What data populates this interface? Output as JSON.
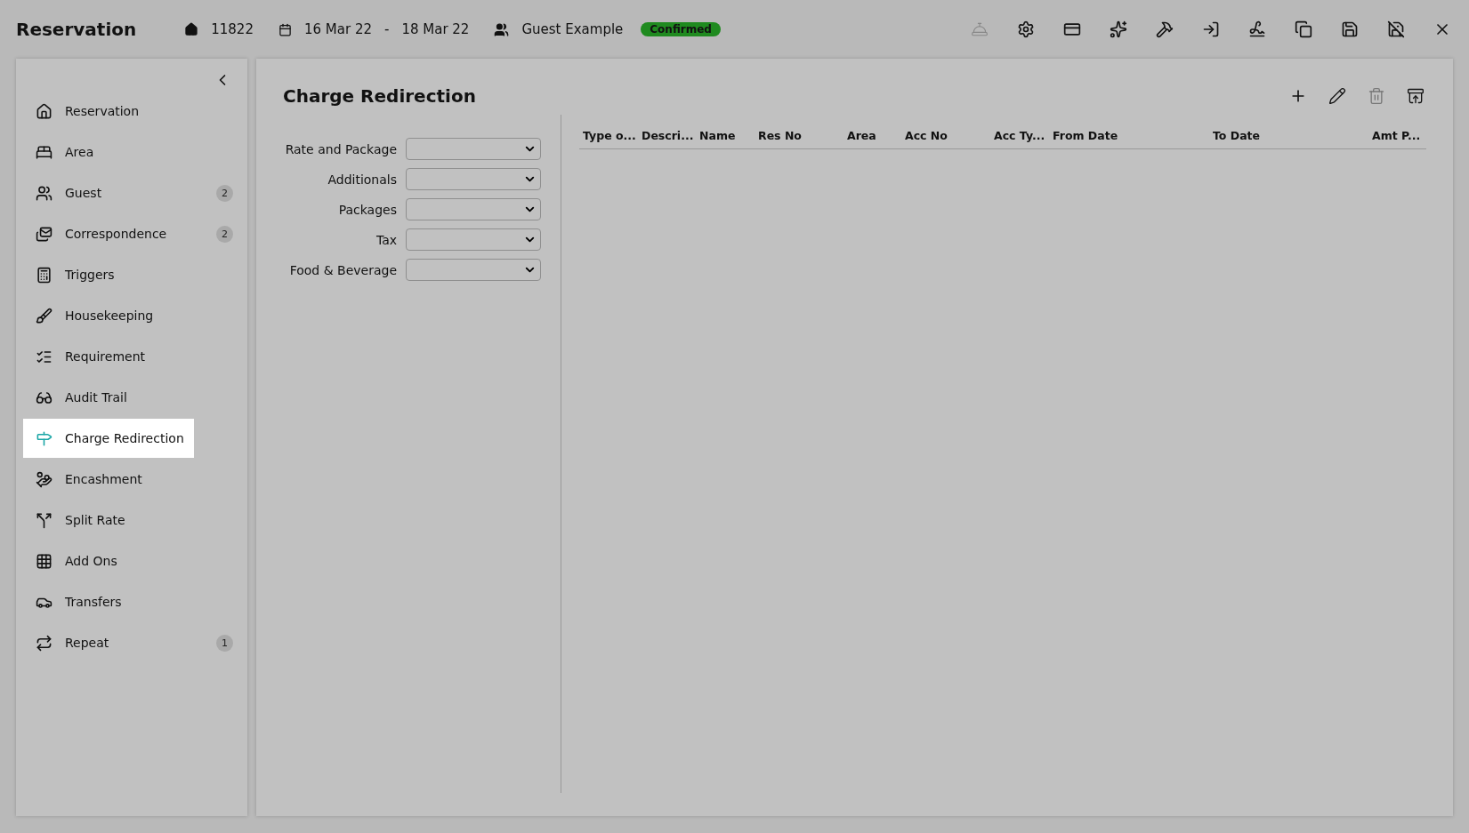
{
  "header": {
    "title": "Reservation",
    "reservation_no": "11822",
    "date_from": "16 Mar 22",
    "date_separator": "-",
    "date_to": "18 Mar 22",
    "guest": "Guest Example",
    "status": "Confirmed"
  },
  "toolbar": [
    {
      "kind": "bell",
      "disabled": true
    },
    {
      "kind": "settings",
      "disabled": false
    },
    {
      "kind": "card",
      "disabled": false
    },
    {
      "kind": "sparkles",
      "disabled": false
    },
    {
      "kind": "hammer",
      "disabled": false
    },
    {
      "kind": "login",
      "disabled": false
    },
    {
      "kind": "signature",
      "disabled": false
    },
    {
      "kind": "copy",
      "disabled": false
    },
    {
      "kind": "save",
      "disabled": false
    },
    {
      "kind": "save-close",
      "disabled": false
    },
    {
      "kind": "close",
      "disabled": false
    }
  ],
  "sidebar": {
    "items": [
      {
        "kind": "home",
        "label": "Reservation",
        "selected": false
      },
      {
        "kind": "bed",
        "label": "Area",
        "selected": false
      },
      {
        "kind": "users",
        "label": "Guest",
        "badge": "2",
        "selected": false
      },
      {
        "kind": "mail",
        "label": "Correspondence",
        "badge": "2",
        "selected": false
      },
      {
        "kind": "calc",
        "label": "Triggers",
        "selected": false
      },
      {
        "kind": "broom",
        "label": "Housekeeping",
        "selected": false
      },
      {
        "kind": "list",
        "label": "Requirement",
        "selected": false
      },
      {
        "kind": "glasses",
        "label": "Audit Trail",
        "selected": false
      },
      {
        "kind": "redirect",
        "label": "Charge Redirection",
        "selected": true
      },
      {
        "kind": "hand",
        "label": "Encashment",
        "selected": false
      },
      {
        "kind": "split",
        "label": "Split Rate",
        "selected": false
      },
      {
        "kind": "grid",
        "label": "Add Ons",
        "selected": false
      },
      {
        "kind": "car",
        "label": "Transfers",
        "selected": false
      },
      {
        "kind": "repeat",
        "label": "Repeat",
        "badge": "1",
        "selected": false
      }
    ]
  },
  "panel": {
    "title": "Charge Redirection",
    "actions": [
      {
        "kind": "add",
        "disabled": false
      },
      {
        "kind": "edit",
        "disabled": false
      },
      {
        "kind": "delete",
        "disabled": true
      },
      {
        "kind": "delete-restore",
        "disabled": false
      }
    ],
    "filters": [
      {
        "label": "Rate and Package"
      },
      {
        "label": "Additionals"
      },
      {
        "label": "Packages"
      },
      {
        "label": "Tax"
      },
      {
        "label": "Food & Beverage"
      }
    ],
    "table": {
      "columns": [
        "Type o...",
        "Descri...",
        "Name",
        "Res No",
        "Area",
        "Acc No",
        "Acc Ty...",
        "From Date",
        "To Date",
        "Amt P..."
      ]
    }
  }
}
